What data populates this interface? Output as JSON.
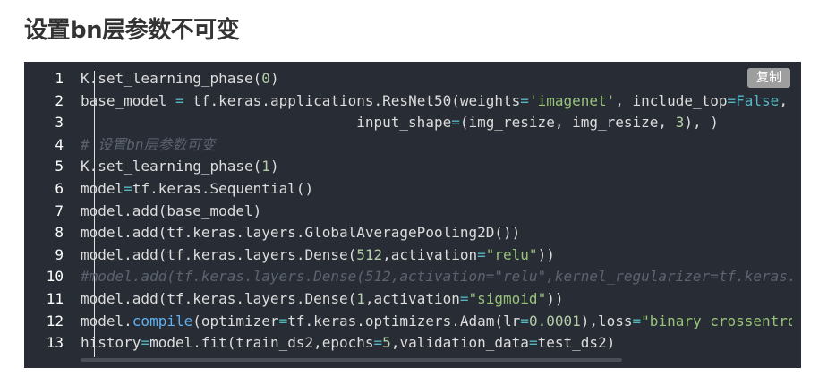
{
  "page": {
    "heading": "设置bn层参数不可变"
  },
  "code_block": {
    "copy_label": "复制",
    "line_numbers": [
      "1",
      "2",
      "3",
      "4",
      "5",
      "6",
      "7",
      "8",
      "9",
      "10",
      "11",
      "12",
      "13"
    ],
    "lines": [
      [
        {
          "t": "K.set_learning_phase(",
          "c": "p"
        },
        {
          "t": "0",
          "c": "num"
        },
        {
          "t": ")",
          "c": "p"
        }
      ],
      [
        {
          "t": "base_model ",
          "c": "p"
        },
        {
          "t": "=",
          "c": "op"
        },
        {
          "t": " tf.keras.applications.ResNet50(weights",
          "c": "p"
        },
        {
          "t": "=",
          "c": "op"
        },
        {
          "t": "'imagenet'",
          "c": "str"
        },
        {
          "t": ", include_top",
          "c": "p"
        },
        {
          "t": "=",
          "c": "op"
        },
        {
          "t": "False",
          "c": "kw"
        },
        {
          "t": ",",
          "c": "p"
        }
      ],
      [
        {
          "t": "                                input_shape",
          "c": "p"
        },
        {
          "t": "=",
          "c": "op"
        },
        {
          "t": "(img_resize, img_resize, ",
          "c": "p"
        },
        {
          "t": "3",
          "c": "num"
        },
        {
          "t": "), )",
          "c": "p"
        }
      ],
      [
        {
          "t": "# 设置bn层参数可变",
          "c": "com"
        }
      ],
      [
        {
          "t": "K.set_learning_phase(",
          "c": "p"
        },
        {
          "t": "1",
          "c": "num"
        },
        {
          "t": ")",
          "c": "p"
        }
      ],
      [
        {
          "t": "model",
          "c": "p"
        },
        {
          "t": "=",
          "c": "op"
        },
        {
          "t": "tf.keras.Sequential()",
          "c": "p"
        }
      ],
      [
        {
          "t": "model.add(base_model)",
          "c": "p"
        }
      ],
      [
        {
          "t": "model.add(tf.keras.layers.GlobalAveragePooling2D())",
          "c": "p"
        }
      ],
      [
        {
          "t": "model.add(tf.keras.layers.Dense(",
          "c": "p"
        },
        {
          "t": "512",
          "c": "num"
        },
        {
          "t": ",activation",
          "c": "p"
        },
        {
          "t": "=",
          "c": "op"
        },
        {
          "t": "\"relu\"",
          "c": "str"
        },
        {
          "t": "))",
          "c": "p"
        }
      ],
      [
        {
          "t": "#model.add(tf.keras.layers.Dense(512,activation=\"relu\",kernel_regularizer=tf.keras.",
          "c": "com"
        }
      ],
      [
        {
          "t": "model.add(tf.keras.layers.Dense(",
          "c": "p"
        },
        {
          "t": "1",
          "c": "num"
        },
        {
          "t": ",activation",
          "c": "p"
        },
        {
          "t": "=",
          "c": "op"
        },
        {
          "t": "\"sigmoid\"",
          "c": "str"
        },
        {
          "t": "))",
          "c": "p"
        }
      ],
      [
        {
          "t": "model.",
          "c": "p"
        },
        {
          "t": "compile",
          "c": "fn"
        },
        {
          "t": "(optimizer",
          "c": "p"
        },
        {
          "t": "=",
          "c": "op"
        },
        {
          "t": "tf.keras.optimizers.Adam(lr",
          "c": "p"
        },
        {
          "t": "=",
          "c": "op"
        },
        {
          "t": "0.0001",
          "c": "num"
        },
        {
          "t": "),loss",
          "c": "p"
        },
        {
          "t": "=",
          "c": "op"
        },
        {
          "t": "\"binary_crossentro",
          "c": "str"
        }
      ],
      [
        {
          "t": "history",
          "c": "p"
        },
        {
          "t": "=",
          "c": "op"
        },
        {
          "t": "model.fit(train_ds2,epochs",
          "c": "p"
        },
        {
          "t": "=",
          "c": "op"
        },
        {
          "t": "5",
          "c": "num"
        },
        {
          "t": ",validation_data",
          "c": "p"
        },
        {
          "t": "=",
          "c": "op"
        },
        {
          "t": "test_ds2)",
          "c": "p"
        }
      ]
    ]
  }
}
